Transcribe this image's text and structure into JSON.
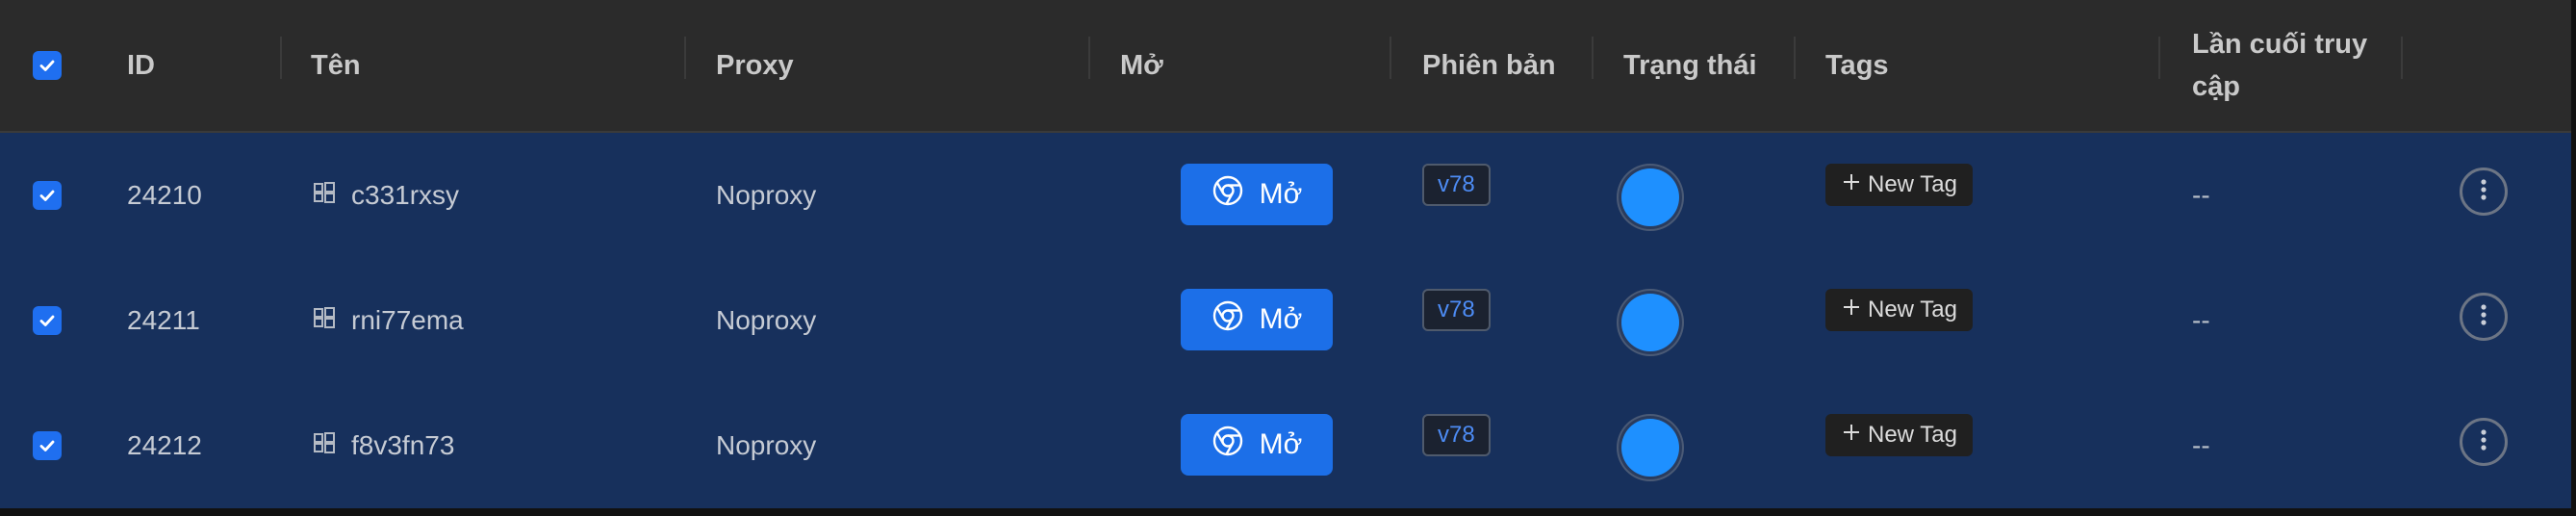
{
  "header": {
    "id": "ID",
    "name": "Tên",
    "proxy": "Proxy",
    "open": "Mở",
    "version": "Phiên bản",
    "status": "Trạng thái",
    "tags": "Tags",
    "last_access_line1": "Lần cuối truy",
    "last_access_line2": "cập"
  },
  "rows": [
    {
      "id": "24210",
      "name": "c331rxsy",
      "proxy": "Noproxy",
      "open_label": "Mở",
      "version": "v78",
      "tag_label": "New Tag",
      "last_access": "--"
    },
    {
      "id": "24211",
      "name": "rni77ema",
      "proxy": "Noproxy",
      "open_label": "Mở",
      "version": "v78",
      "tag_label": "New Tag",
      "last_access": "--"
    },
    {
      "id": "24212",
      "name": "f8v3fn73",
      "proxy": "Noproxy",
      "open_label": "Mở",
      "version": "v78",
      "tag_label": "New Tag",
      "last_access": "--"
    }
  ],
  "colors": {
    "header_bg": "#2b2b2b",
    "row_bg": "#17305c",
    "accent": "#1c6fe8",
    "status_dot": "#1e90ff",
    "version_text": "#4d8cf5"
  },
  "icons": {
    "select_all": "checkbox-checked-icon",
    "row_select": "checkbox-checked-icon",
    "name_os": "windows-icon",
    "open": "chrome-icon",
    "tag_add": "plus-icon",
    "row_actions": "more-vertical-icon"
  }
}
